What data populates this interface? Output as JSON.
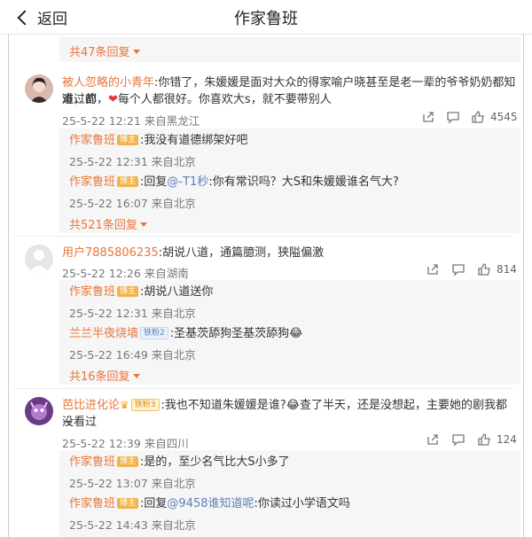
{
  "header": {
    "back_label": "返回",
    "title": "作家鲁班"
  },
  "top_more": "共47条回复",
  "comments": [
    {
      "user": "被人忽略的小青年",
      "text_line1": ":你错了，朱媛媛是面对大众的得家喻户晓甚至是老一辈的爷爷奶奶都知道，都",
      "text_line2_a": "难过的，",
      "text_line2_b": "每个人都很好。你喜欢大s，就不要带别人",
      "time": "25-5-22 12:21 来自黑龙江",
      "likes": "4545",
      "replies": [
        {
          "user": "作家鲁班",
          "badge": "博主",
          "text": ":我没有道德绑架好吧",
          "time": "25-5-22 12:31 来自北京"
        },
        {
          "user": "作家鲁班",
          "badge": "博主",
          "text_a": ":回复",
          "mention": "@-T1秒",
          "text_b": ":你有常识吗？大S和朱媛媛谁名气大?",
          "time": "25-5-22 16:07 来自北京"
        }
      ],
      "more": "共521条回复"
    },
    {
      "user": "用户7885806235",
      "text": ":胡说八道，通篇臆测，狭隘偏激",
      "time": "25-5-22 12:26 来自湖南",
      "likes": "814",
      "replies": [
        {
          "user": "作家鲁班",
          "badge": "博主",
          "text": ":胡说八道送你",
          "time": "25-5-22 12:31 来自北京"
        },
        {
          "user": "兰兰半夜烧墙",
          "badge": "铁粉2",
          "text": ":圣基茨舔狗圣基茨舔狗",
          "time": "25-5-22 16:49 来自北京"
        }
      ],
      "more": "共16条回复"
    },
    {
      "user": "芭比进化论",
      "badge": "铁粉3",
      "text_line1_a": ":我也不知道朱媛媛是谁?",
      "text_line1_b": "查了半天，还是没想起，主要她的剧我都没看过",
      "text_line2": "~",
      "time": "25-5-22 12:39 来自四川",
      "likes": "124",
      "replies": [
        {
          "user": "作家鲁班",
          "badge": "博主",
          "text": ":是的，至少名气比大S小多了",
          "time": "25-5-22 13:07 来自北京"
        },
        {
          "user": "作家鲁班",
          "badge": "博主",
          "text_a": ":回复",
          "mention": "@9458谁知道呢",
          "text_b": ":你读过小学语文吗",
          "time": "25-5-22 14:43 来自北京"
        }
      ]
    }
  ]
}
